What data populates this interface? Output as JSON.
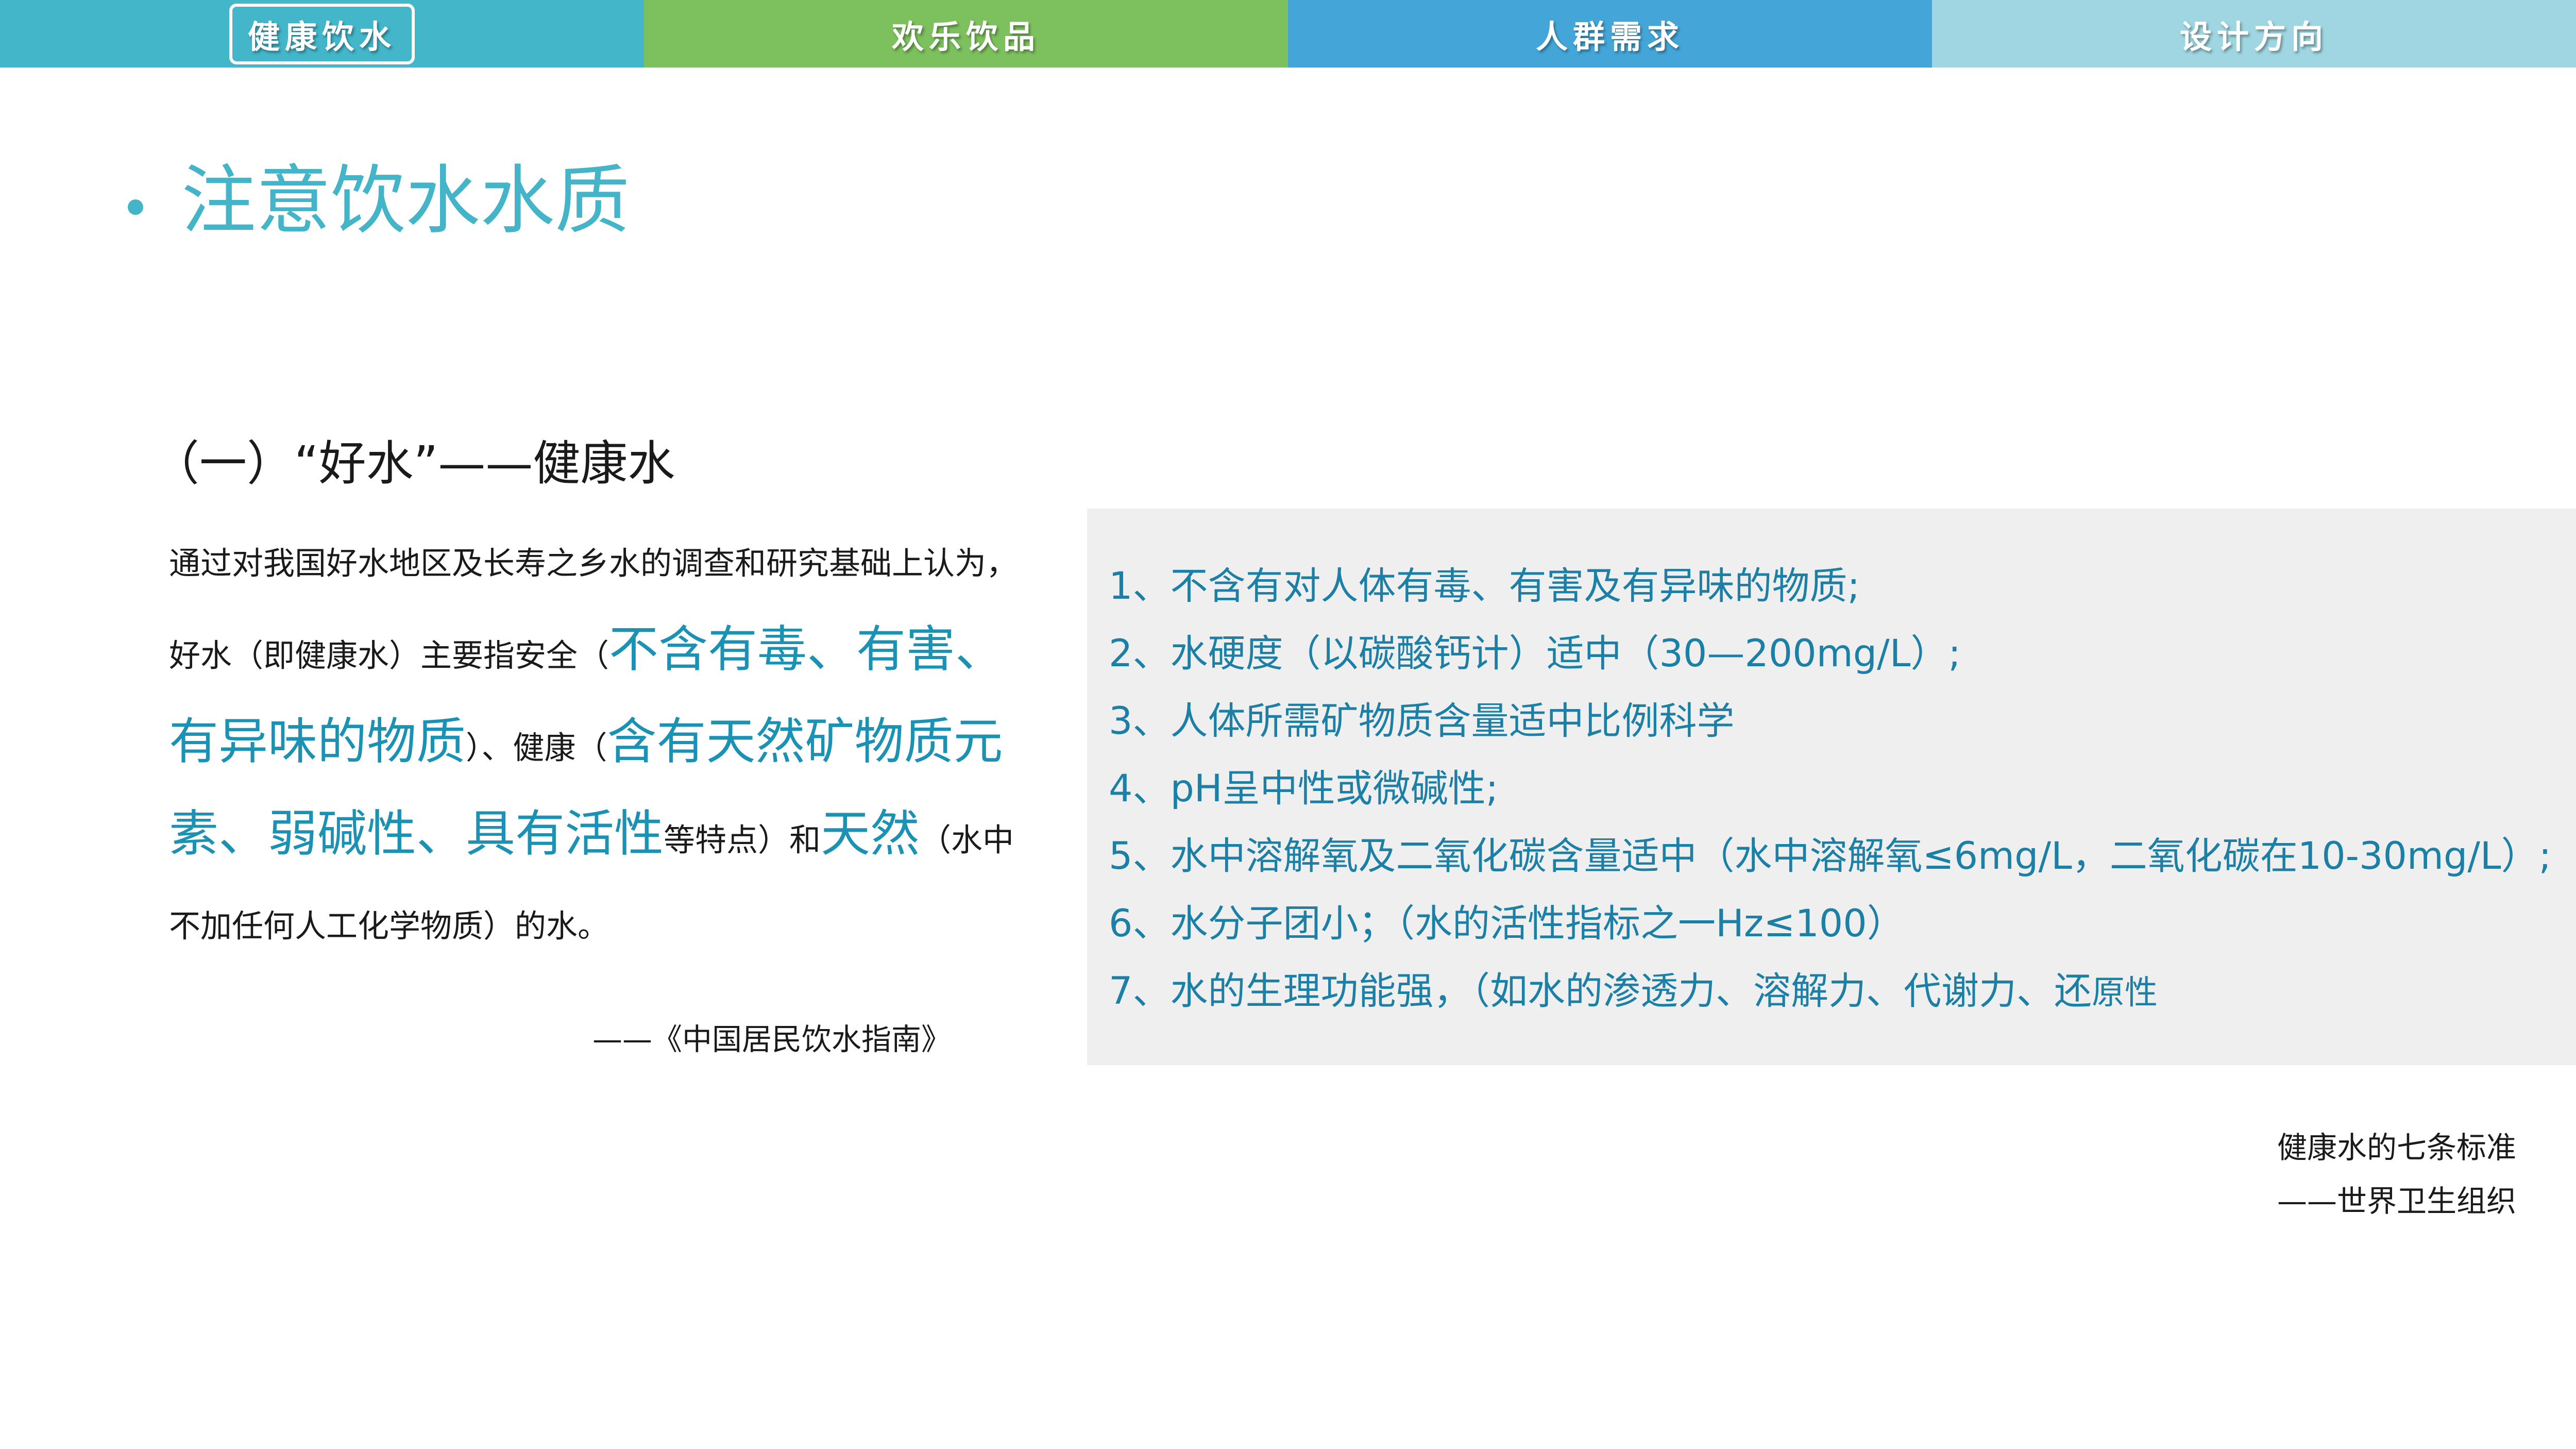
{
  "nav": {
    "tabs": [
      {
        "label": "健康饮水",
        "active": true
      },
      {
        "label": "欢乐饮品",
        "active": false
      },
      {
        "label": "人群需求",
        "active": false
      },
      {
        "label": "设计方向",
        "active": false
      }
    ]
  },
  "page": {
    "title": "注意饮水水质"
  },
  "section": {
    "heading": "（一）“好水”——健康水"
  },
  "intro": {
    "p1": "通过对我国好水地区及长寿之乡水的调查和研究基础上认为，好水（即健康水）主要指安全（",
    "hl1": "不含有毒、有害、有异味的物质",
    "p2": "）、健康（",
    "hl2": "含有天然矿物质元素、弱碱性、具有活性",
    "p3": "等特点）和",
    "hl3": "天然",
    "p4": "（水中不加任何人工化学物质）的水。"
  },
  "citation": "——《中国居民饮水指南》",
  "standards": {
    "items": [
      {
        "text": "1、不含有对人体有毒、有害及有异味的物质;",
        "tail": ""
      },
      {
        "text": "2、水硬度（以碳酸钙计）适中（30—200mg/L）;",
        "tail": ""
      },
      {
        "text": "3、人体所需矿物质含量适中比例科学",
        "tail": ""
      },
      {
        "text": "4、pH呈中性或微碱性;",
        "tail": ""
      },
      {
        "text": "5、水中溶解氧及二氧化碳含量适中（水中溶解氧≤6mg/L，二氧化碳在10-30mg/L）;",
        "tail": ""
      },
      {
        "text": "6、水分子团小；（水的活性指标之一Hz≤100）",
        "tail": ""
      },
      {
        "text": "7、水的生理功能强，（如水的渗透力、溶解力、代谢力、还",
        "tail": "原性"
      }
    ]
  },
  "caption": {
    "line1": "健康水的七条标准",
    "line2": "——世界卫生组织"
  }
}
